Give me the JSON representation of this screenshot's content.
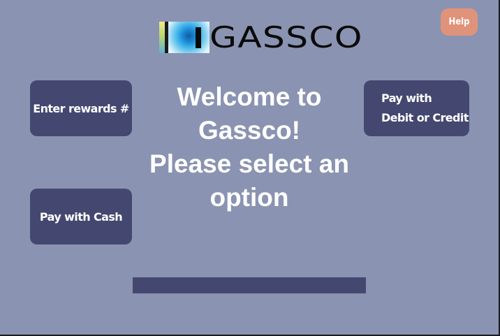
{
  "logo": {
    "text": "GASSCO",
    "icon": "gassco-logo-mark"
  },
  "help": {
    "label": "Help"
  },
  "options": {
    "rewards_label": "Enter rewards #",
    "cash_label": "Pay with Cash",
    "card_label_line1": "Pay with",
    "card_label_line2": "Debit or Credit"
  },
  "welcome": {
    "line1": "Welcome to",
    "line2": "Gassco!",
    "line3": "Please select an",
    "line4": "option"
  },
  "colors": {
    "background": "#8a93b1",
    "button": "#444870",
    "help": "#e0937b",
    "text": "#ffffff"
  }
}
